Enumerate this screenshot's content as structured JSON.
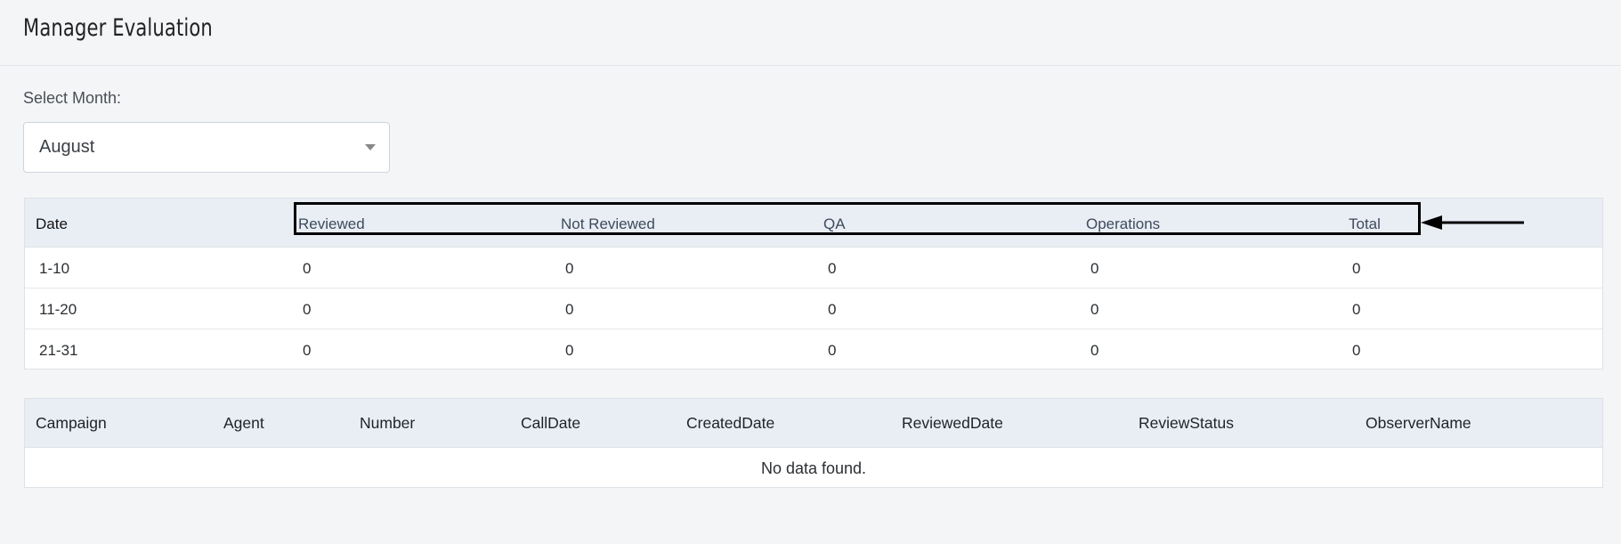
{
  "header": {
    "title": "Manager Evaluation"
  },
  "filter": {
    "label": "Select Month:",
    "selected": "August"
  },
  "summary_table": {
    "columns": [
      "Date",
      "Reviewed",
      "Not Reviewed",
      "QA",
      "Operations",
      "Total"
    ],
    "rows": [
      [
        "1-10",
        "0",
        "0",
        "0",
        "0",
        "0"
      ],
      [
        "11-20",
        "0",
        "0",
        "0",
        "0",
        "0"
      ],
      [
        "21-31",
        "0",
        "0",
        "0",
        "0",
        "0"
      ]
    ]
  },
  "detail_table": {
    "columns": [
      "Campaign",
      "Agent",
      "Number",
      "CallDate",
      "CreatedDate",
      "ReviewedDate",
      "ReviewStatus",
      "ObserverName"
    ],
    "empty_message": "No data found."
  },
  "annotation": {
    "highlight_color": "#000000",
    "icon": "arrow-left-icon"
  }
}
